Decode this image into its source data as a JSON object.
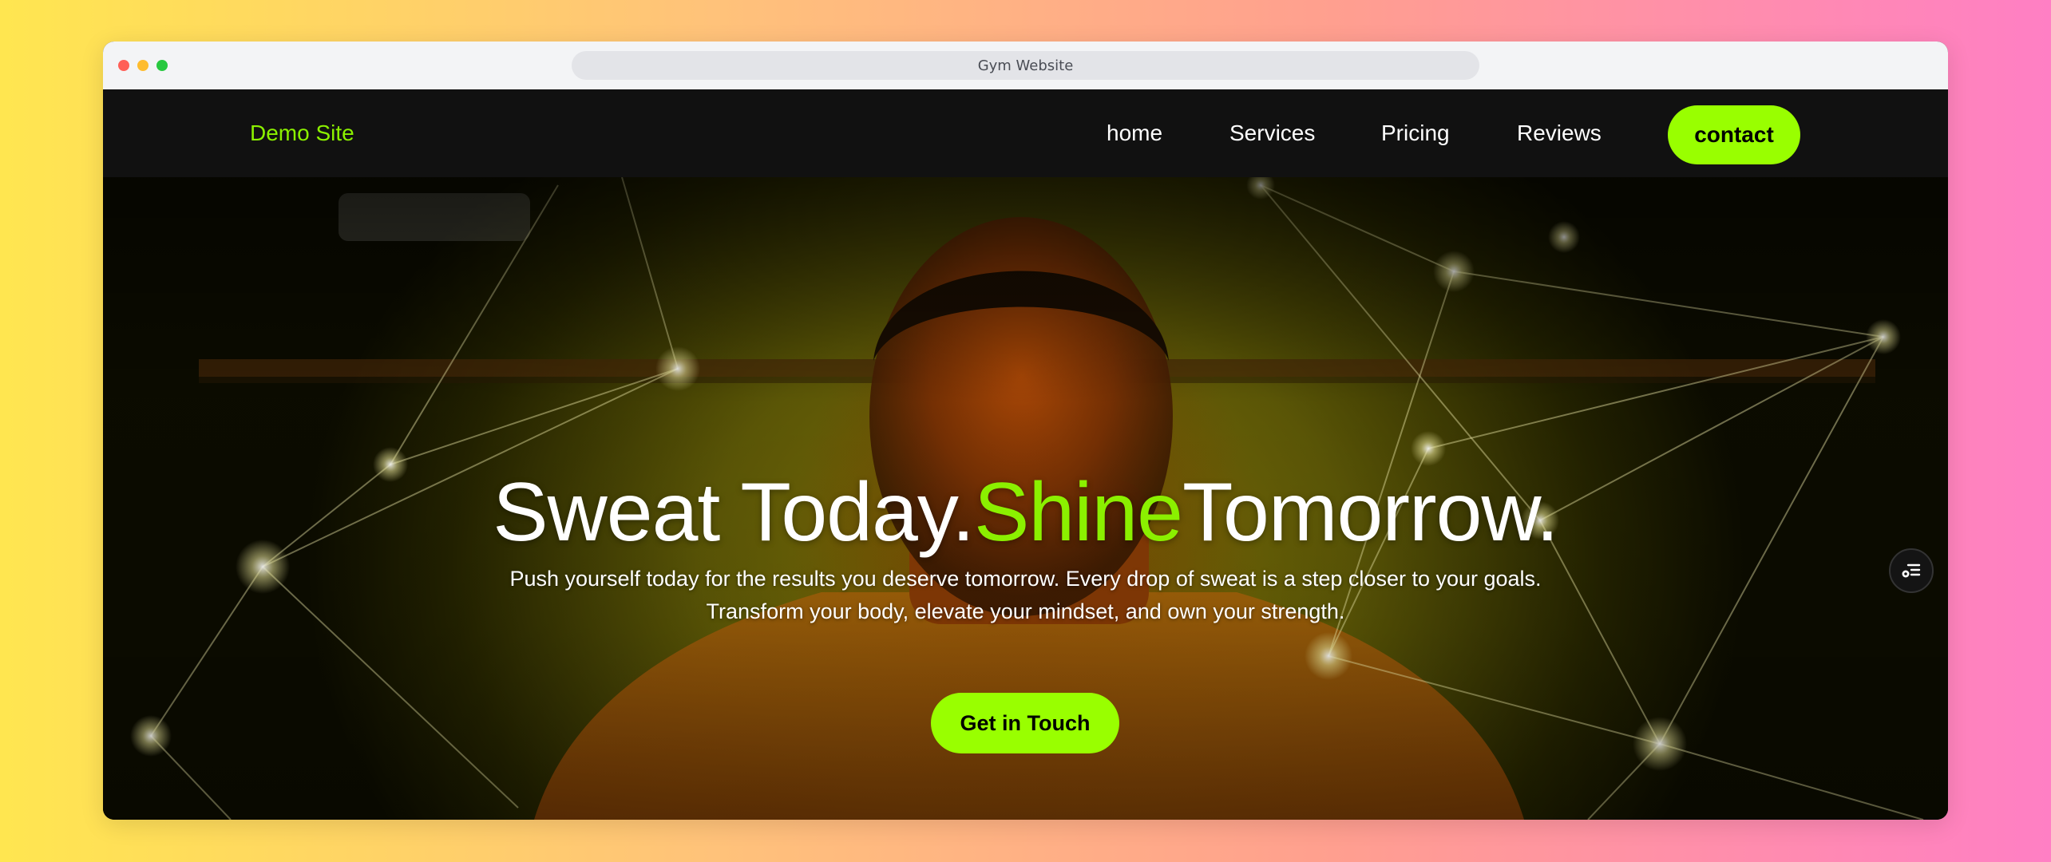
{
  "window": {
    "title": "Gym Website",
    "traffic_lights": [
      "#ff5f57",
      "#febc2e",
      "#28c840"
    ]
  },
  "nav": {
    "brand": "Demo Site",
    "links": [
      "home",
      "Services",
      "Pricing",
      "Reviews"
    ],
    "contact_label": "contact"
  },
  "hero": {
    "title_part1": "Sweat Today.",
    "title_accent": "Shine",
    "title_part2": "Tomorrow.",
    "subtitle_line1": "Push yourself today for the results you deserve tomorrow. Every drop of sweat is a step closer to your goals.",
    "subtitle_line2": "Transform your body, elevate your mindset, and own your strength.",
    "cta_label": "Get in Touch"
  },
  "floating_button": {
    "icon": "sliders-icon"
  },
  "colors": {
    "accent": "#99ff00",
    "accent_text": "#8bf000",
    "nav_bg": "#111111"
  }
}
